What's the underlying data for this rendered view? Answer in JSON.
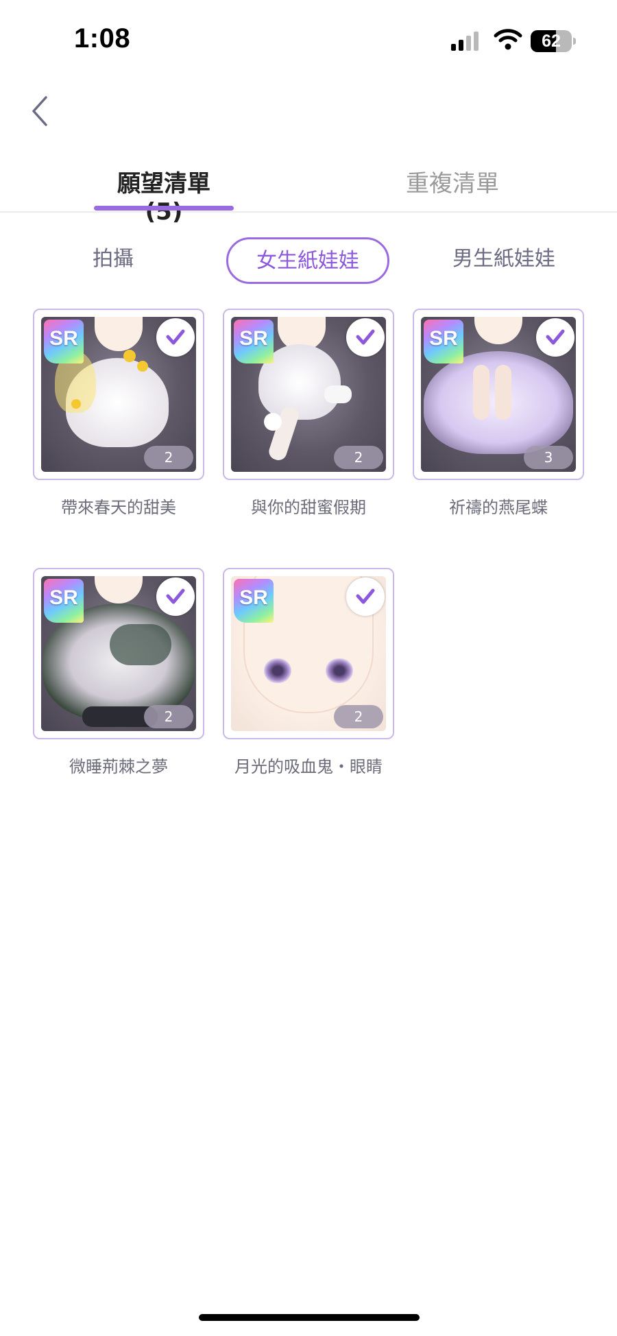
{
  "status_bar": {
    "time": "1:08",
    "battery_level": "62",
    "battery_fraction": 0.62
  },
  "nav": {
    "back_icon": "chevron-left-icon"
  },
  "tabs": [
    {
      "label": "願望清單 (5)",
      "active": true
    },
    {
      "label": "重複清單",
      "active": false
    }
  ],
  "filters": [
    {
      "label": "拍攝",
      "selected": false
    },
    {
      "label": "女生紙娃娃",
      "selected": true
    },
    {
      "label": "男生紙娃娃",
      "selected": false
    }
  ],
  "items": [
    {
      "name": "帶來春天的甜美",
      "rarity": "SR",
      "count": "2",
      "checked": true,
      "art": "dark"
    },
    {
      "name": "與你的甜蜜假期",
      "rarity": "SR",
      "count": "2",
      "checked": true,
      "art": "dark"
    },
    {
      "name": "祈禱的燕尾蝶",
      "rarity": "SR",
      "count": "3",
      "checked": true,
      "art": "dark"
    },
    {
      "name": "微睡荊棘之夢",
      "rarity": "SR",
      "count": "2",
      "checked": true,
      "art": "dark"
    },
    {
      "name": "月光的吸血鬼・眼睛",
      "rarity": "SR",
      "count": "2",
      "checked": true,
      "art": "light"
    }
  ],
  "colors": {
    "accent": "#9a6ae0",
    "card_border": "#c9b8ea",
    "muted_text": "#6b6b7a"
  }
}
